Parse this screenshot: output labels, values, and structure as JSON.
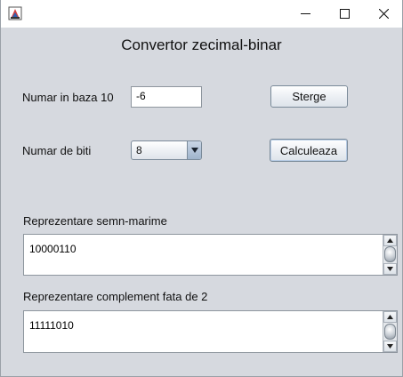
{
  "window": {
    "controls": {
      "minimize_icon": "minimize-icon",
      "maximize_icon": "maximize-icon",
      "close_icon": "close-icon"
    }
  },
  "heading": "Convertor zecimal-binar",
  "input": {
    "label": "Numar in baza 10",
    "value": "-6"
  },
  "bits": {
    "label": "Numar de biti",
    "selected": "8"
  },
  "buttons": {
    "clear": "Sterge",
    "calculate": "Calculeaza"
  },
  "sign_magnitude": {
    "label": "Reprezentare semn-marime",
    "value": "10000110"
  },
  "twos_complement": {
    "label": "Reprezentare complement fata de 2",
    "value": "11111010"
  },
  "colors": {
    "background": "#d6d9df",
    "titlebar": "#ffffff"
  }
}
